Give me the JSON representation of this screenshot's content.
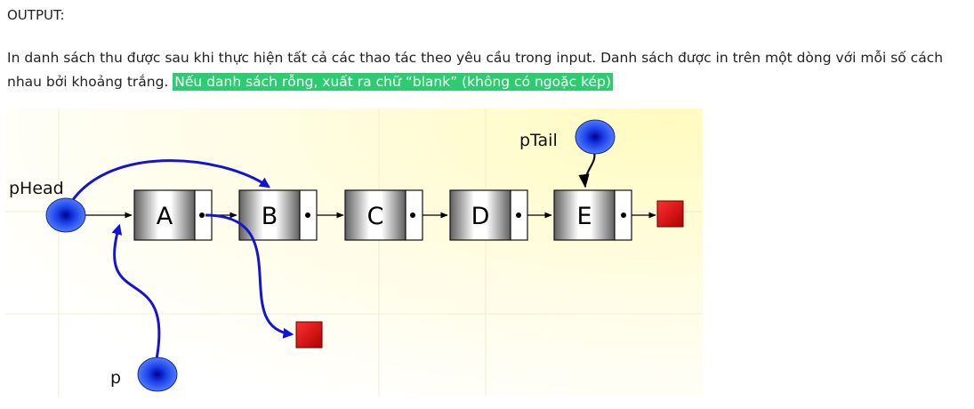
{
  "heading": "OUTPUT:",
  "paragraph": {
    "text_line_1": "In danh sách thu được sau khi thực hiện tất cả các thao tác theo yêu cầu trong input. Danh sách được in trên một dòng với mỗi số cách",
    "text_line_2": "nhau bởi khoảng trắng. ",
    "highlight": "Nếu danh sách rỗng, xuất ra chữ “blank” (không có ngoặc kép)"
  },
  "diagram": {
    "nodes": [
      "A",
      "B",
      "C",
      "D",
      "E"
    ],
    "pointers": {
      "head": "pHead",
      "tail": "pTail",
      "p": "p"
    },
    "colors": {
      "pointer": "#1f3fe0",
      "null_box": "#e00000",
      "arrow": "#1414d6"
    }
  }
}
